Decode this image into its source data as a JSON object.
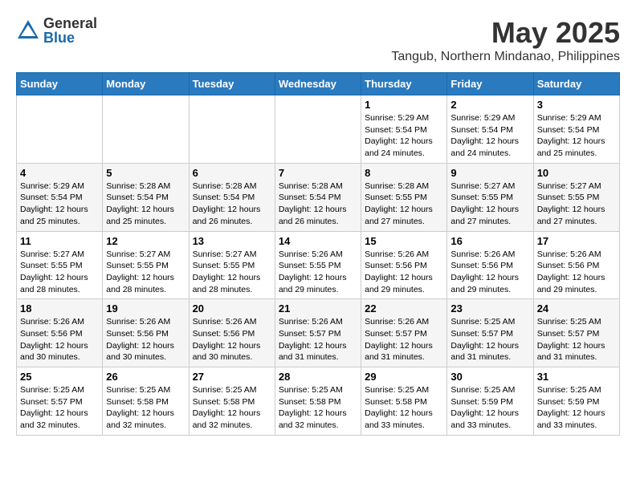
{
  "logo": {
    "general": "General",
    "blue": "Blue"
  },
  "title": "May 2025",
  "location": "Tangub, Northern Mindanao, Philippines",
  "days_of_week": [
    "Sunday",
    "Monday",
    "Tuesday",
    "Wednesday",
    "Thursday",
    "Friday",
    "Saturday"
  ],
  "weeks": [
    [
      {
        "day": "",
        "content": ""
      },
      {
        "day": "",
        "content": ""
      },
      {
        "day": "",
        "content": ""
      },
      {
        "day": "",
        "content": ""
      },
      {
        "day": "1",
        "content": "Sunrise: 5:29 AM\nSunset: 5:54 PM\nDaylight: 12 hours\nand 24 minutes."
      },
      {
        "day": "2",
        "content": "Sunrise: 5:29 AM\nSunset: 5:54 PM\nDaylight: 12 hours\nand 24 minutes."
      },
      {
        "day": "3",
        "content": "Sunrise: 5:29 AM\nSunset: 5:54 PM\nDaylight: 12 hours\nand 25 minutes."
      }
    ],
    [
      {
        "day": "4",
        "content": "Sunrise: 5:29 AM\nSunset: 5:54 PM\nDaylight: 12 hours\nand 25 minutes."
      },
      {
        "day": "5",
        "content": "Sunrise: 5:28 AM\nSunset: 5:54 PM\nDaylight: 12 hours\nand 25 minutes."
      },
      {
        "day": "6",
        "content": "Sunrise: 5:28 AM\nSunset: 5:54 PM\nDaylight: 12 hours\nand 26 minutes."
      },
      {
        "day": "7",
        "content": "Sunrise: 5:28 AM\nSunset: 5:54 PM\nDaylight: 12 hours\nand 26 minutes."
      },
      {
        "day": "8",
        "content": "Sunrise: 5:28 AM\nSunset: 5:55 PM\nDaylight: 12 hours\nand 27 minutes."
      },
      {
        "day": "9",
        "content": "Sunrise: 5:27 AM\nSunset: 5:55 PM\nDaylight: 12 hours\nand 27 minutes."
      },
      {
        "day": "10",
        "content": "Sunrise: 5:27 AM\nSunset: 5:55 PM\nDaylight: 12 hours\nand 27 minutes."
      }
    ],
    [
      {
        "day": "11",
        "content": "Sunrise: 5:27 AM\nSunset: 5:55 PM\nDaylight: 12 hours\nand 28 minutes."
      },
      {
        "day": "12",
        "content": "Sunrise: 5:27 AM\nSunset: 5:55 PM\nDaylight: 12 hours\nand 28 minutes."
      },
      {
        "day": "13",
        "content": "Sunrise: 5:27 AM\nSunset: 5:55 PM\nDaylight: 12 hours\nand 28 minutes."
      },
      {
        "day": "14",
        "content": "Sunrise: 5:26 AM\nSunset: 5:55 PM\nDaylight: 12 hours\nand 29 minutes."
      },
      {
        "day": "15",
        "content": "Sunrise: 5:26 AM\nSunset: 5:56 PM\nDaylight: 12 hours\nand 29 minutes."
      },
      {
        "day": "16",
        "content": "Sunrise: 5:26 AM\nSunset: 5:56 PM\nDaylight: 12 hours\nand 29 minutes."
      },
      {
        "day": "17",
        "content": "Sunrise: 5:26 AM\nSunset: 5:56 PM\nDaylight: 12 hours\nand 29 minutes."
      }
    ],
    [
      {
        "day": "18",
        "content": "Sunrise: 5:26 AM\nSunset: 5:56 PM\nDaylight: 12 hours\nand 30 minutes."
      },
      {
        "day": "19",
        "content": "Sunrise: 5:26 AM\nSunset: 5:56 PM\nDaylight: 12 hours\nand 30 minutes."
      },
      {
        "day": "20",
        "content": "Sunrise: 5:26 AM\nSunset: 5:56 PM\nDaylight: 12 hours\nand 30 minutes."
      },
      {
        "day": "21",
        "content": "Sunrise: 5:26 AM\nSunset: 5:57 PM\nDaylight: 12 hours\nand 31 minutes."
      },
      {
        "day": "22",
        "content": "Sunrise: 5:26 AM\nSunset: 5:57 PM\nDaylight: 12 hours\nand 31 minutes."
      },
      {
        "day": "23",
        "content": "Sunrise: 5:25 AM\nSunset: 5:57 PM\nDaylight: 12 hours\nand 31 minutes."
      },
      {
        "day": "24",
        "content": "Sunrise: 5:25 AM\nSunset: 5:57 PM\nDaylight: 12 hours\nand 31 minutes."
      }
    ],
    [
      {
        "day": "25",
        "content": "Sunrise: 5:25 AM\nSunset: 5:57 PM\nDaylight: 12 hours\nand 32 minutes."
      },
      {
        "day": "26",
        "content": "Sunrise: 5:25 AM\nSunset: 5:58 PM\nDaylight: 12 hours\nand 32 minutes."
      },
      {
        "day": "27",
        "content": "Sunrise: 5:25 AM\nSunset: 5:58 PM\nDaylight: 12 hours\nand 32 minutes."
      },
      {
        "day": "28",
        "content": "Sunrise: 5:25 AM\nSunset: 5:58 PM\nDaylight: 12 hours\nand 32 minutes."
      },
      {
        "day": "29",
        "content": "Sunrise: 5:25 AM\nSunset: 5:58 PM\nDaylight: 12 hours\nand 33 minutes."
      },
      {
        "day": "30",
        "content": "Sunrise: 5:25 AM\nSunset: 5:59 PM\nDaylight: 12 hours\nand 33 minutes."
      },
      {
        "day": "31",
        "content": "Sunrise: 5:25 AM\nSunset: 5:59 PM\nDaylight: 12 hours\nand 33 minutes."
      }
    ]
  ]
}
